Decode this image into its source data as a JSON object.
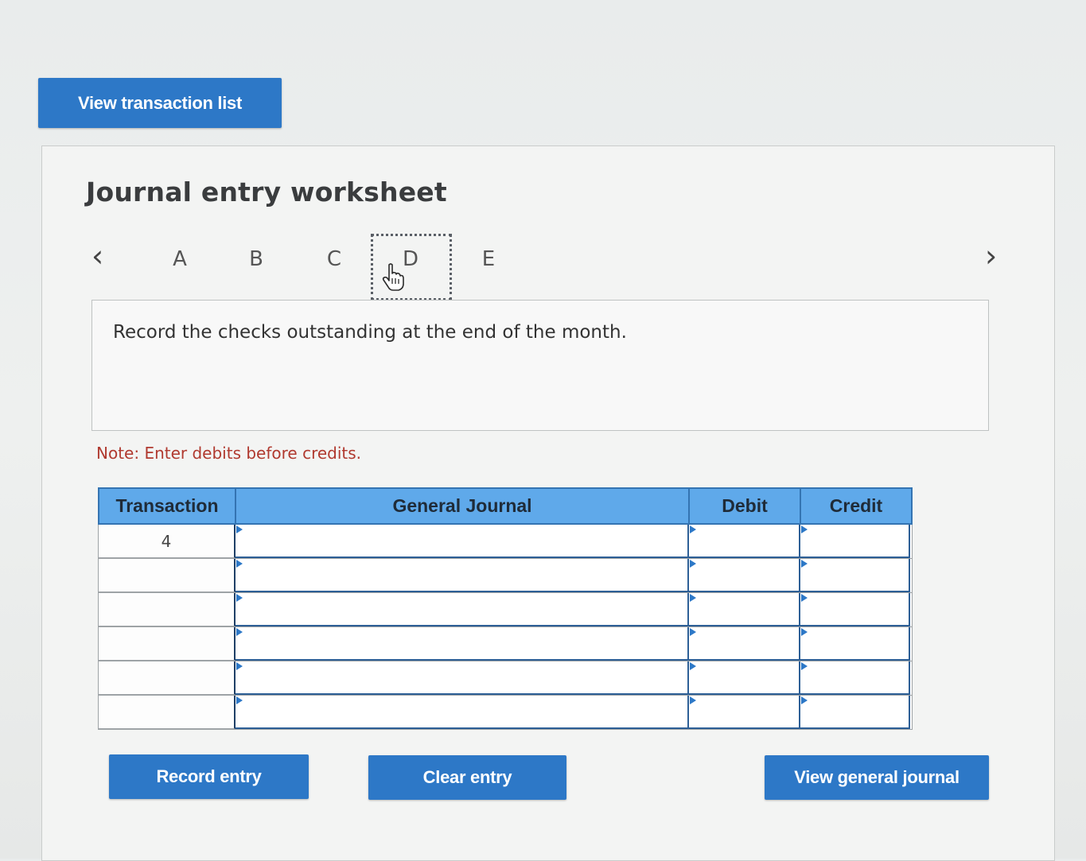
{
  "top_button": {
    "label": "View transaction list"
  },
  "worksheet": {
    "title": "Journal entry worksheet",
    "tabs": [
      "A",
      "B",
      "C",
      "D",
      "E"
    ],
    "active_tab": "D",
    "question": "Record the checks outstanding at the end of the month.",
    "note": "Note: Enter debits before credits."
  },
  "table": {
    "headers": [
      "Transaction",
      "General Journal",
      "Debit",
      "Credit"
    ],
    "rows": [
      {
        "transaction": "4",
        "general_journal": "",
        "debit": "",
        "credit": ""
      },
      {
        "transaction": "",
        "general_journal": "",
        "debit": "",
        "credit": ""
      },
      {
        "transaction": "",
        "general_journal": "",
        "debit": "",
        "credit": ""
      },
      {
        "transaction": "",
        "general_journal": "",
        "debit": "",
        "credit": ""
      },
      {
        "transaction": "",
        "general_journal": "",
        "debit": "",
        "credit": ""
      },
      {
        "transaction": "",
        "general_journal": "",
        "debit": "",
        "credit": ""
      }
    ]
  },
  "actions": {
    "record_entry": "Record entry",
    "clear_entry": "Clear entry",
    "view_general_journal": "View general journal"
  },
  "colors": {
    "button_blue": "#2d78c7",
    "header_blue": "#5fa9ea",
    "note_red": "#b0392f"
  }
}
